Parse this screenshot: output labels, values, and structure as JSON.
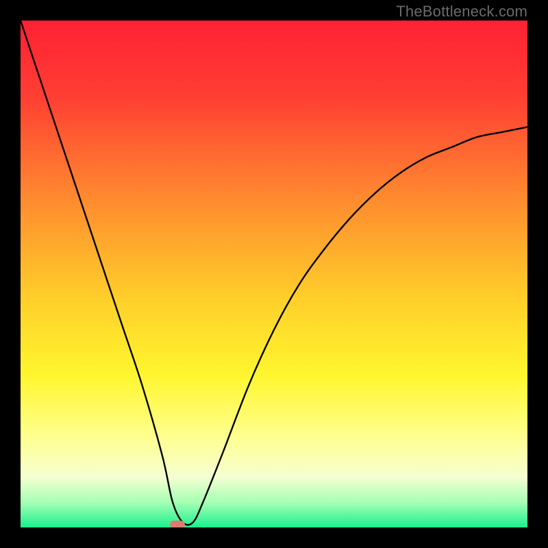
{
  "watermark": "TheBottleneck.com",
  "colors": {
    "black": "#000000",
    "curve": "#000000",
    "marker": "#de7a72",
    "watermark": "#6b6b6b"
  },
  "chart_data": {
    "type": "line",
    "title": "",
    "xlabel": "",
    "ylabel": "",
    "xlim": [
      0,
      100
    ],
    "ylim": [
      0,
      100
    ],
    "gradient_stops": [
      {
        "pos": 0,
        "color": "#ff2133"
      },
      {
        "pos": 15,
        "color": "#ff3e33"
      },
      {
        "pos": 35,
        "color": "#ff8a2f"
      },
      {
        "pos": 55,
        "color": "#ffcf2a"
      },
      {
        "pos": 70,
        "color": "#fff62e"
      },
      {
        "pos": 82,
        "color": "#ffff8e"
      },
      {
        "pos": 90,
        "color": "#f5ffd1"
      },
      {
        "pos": 95,
        "color": "#a7ffb5"
      },
      {
        "pos": 100,
        "color": "#1af08e"
      }
    ],
    "series": [
      {
        "name": "bottleneck-curve",
        "x": [
          0,
          4,
          8,
          12,
          16,
          20,
          24,
          28,
          30,
          32,
          34,
          36,
          40,
          45,
          50,
          55,
          60,
          65,
          70,
          75,
          80,
          85,
          90,
          95,
          100
        ],
        "y": [
          100,
          88,
          76,
          64,
          52,
          40,
          28,
          14,
          5,
          1,
          1,
          5,
          15,
          28,
          39,
          48,
          55,
          61,
          66,
          70,
          73,
          75,
          77,
          78,
          79
        ]
      }
    ],
    "marker": {
      "x": 31,
      "y": 0.5
    }
  }
}
